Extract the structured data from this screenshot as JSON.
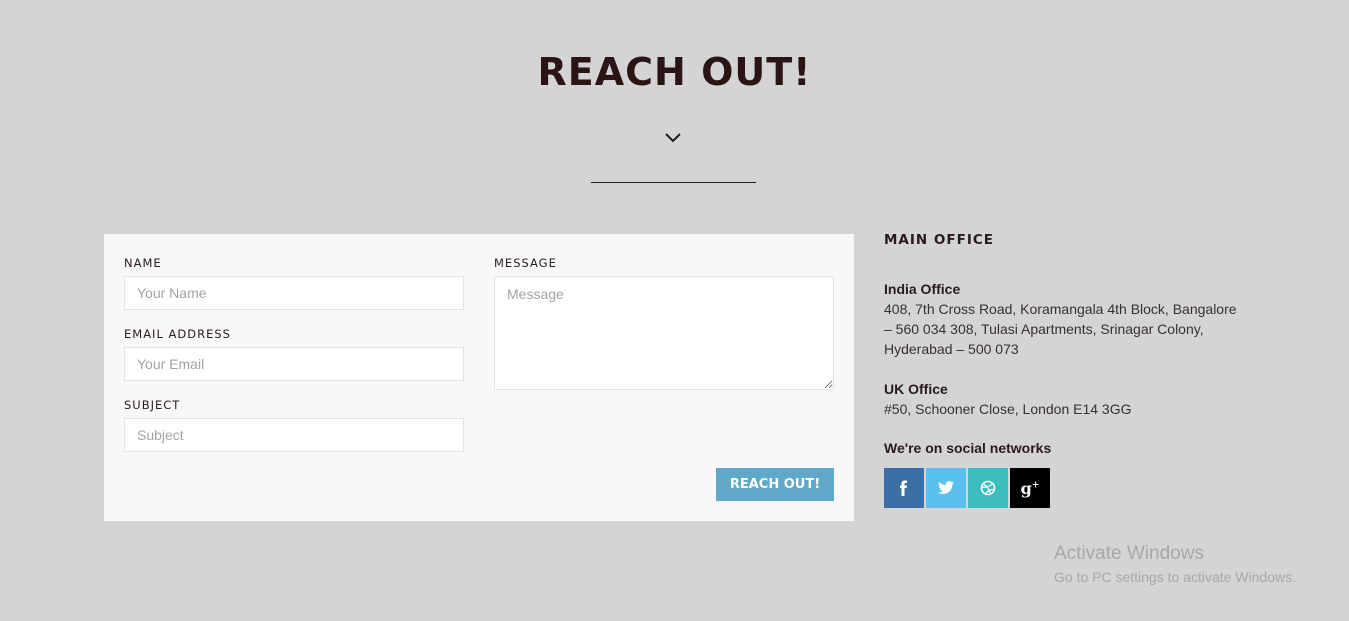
{
  "header": {
    "title": "REACH OUT!"
  },
  "form": {
    "name_label": "NAME",
    "name_placeholder": "Your Name",
    "email_label": "EMAIL ADDRESS",
    "email_placeholder": "Your Email",
    "subject_label": "SUBJECT",
    "subject_placeholder": "Subject",
    "message_label": "MESSAGE",
    "message_placeholder": "Message",
    "submit_label": "REACH OUT!"
  },
  "info": {
    "heading": "MAIN OFFICE",
    "offices": [
      {
        "name": "India Office",
        "address": "408, 7th Cross Road, Koramangala 4th Block, Bangalore – 560 034 308, Tulasi Apartments, Srinagar Colony, Hyderabad – 500 073"
      },
      {
        "name": "UK Office",
        "address": "#50, Schooner Close, London E14 3GG"
      }
    ],
    "social_heading": "We're on social networks",
    "social": [
      {
        "icon": "facebook-icon",
        "glyph": "f",
        "color": "#3b6ea5"
      },
      {
        "icon": "twitter-icon",
        "glyph": "twitter",
        "color": "#5bc0f0"
      },
      {
        "icon": "dribbble-icon",
        "glyph": "dribbble",
        "color": "#3dbdbd"
      },
      {
        "icon": "google-plus-icon",
        "glyph": "g+",
        "color": "#000000"
      }
    ]
  },
  "watermark": {
    "line1": "Activate Windows",
    "line2": "Go to PC settings to activate Windows."
  },
  "colors": {
    "background": "#d4d4d4",
    "card": "#f8f8f8",
    "accent": "#5fa8c9",
    "text": "#2b1a1a"
  }
}
